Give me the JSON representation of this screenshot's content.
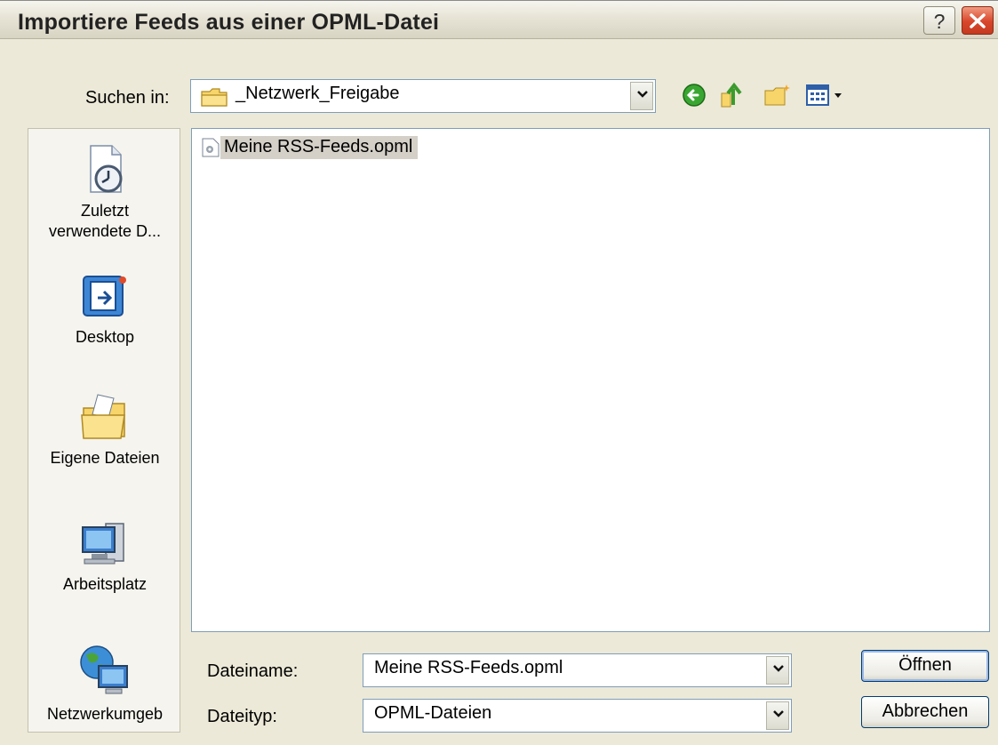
{
  "window": {
    "title": "Importiere Feeds aus einer OPML-Datei"
  },
  "titlebar": {
    "help_label": "?"
  },
  "lookin": {
    "label": "Suchen in:",
    "value": "_Netzwerk_Freigabe"
  },
  "toolbar": {
    "icons": [
      "back-icon",
      "up-folder-icon",
      "new-folder-icon",
      "view-menu-icon"
    ]
  },
  "places": [
    {
      "label": "Zuletzt\nverwendete D...",
      "icon": "recent-documents-icon"
    },
    {
      "label": "Desktop",
      "icon": "desktop-icon"
    },
    {
      "label": "Eigene Dateien",
      "icon": "my-documents-icon"
    },
    {
      "label": "Arbeitsplatz",
      "icon": "my-computer-icon"
    },
    {
      "label": "Netzwerkumgeb",
      "icon": "network-places-icon"
    }
  ],
  "files": [
    {
      "name": "Meine RSS-Feeds.opml",
      "selected": true
    }
  ],
  "filename": {
    "label": "Dateiname:",
    "value": "Meine RSS-Feeds.opml"
  },
  "filetype": {
    "label": "Dateityp:",
    "value": "OPML-Dateien"
  },
  "buttons": {
    "open": "Öffnen",
    "cancel": "Abbrechen"
  },
  "colors": {
    "selection": "#d4d0c8",
    "frame": "#ece9d8",
    "close": "#d8452a"
  }
}
